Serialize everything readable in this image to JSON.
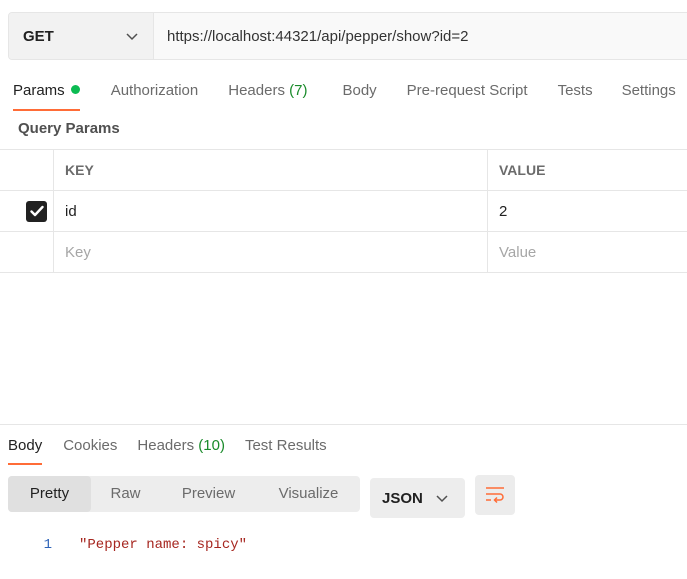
{
  "request": {
    "method": "GET",
    "url": "https://localhost:44321/api/pepper/show?id=2"
  },
  "request_tabs": [
    {
      "label": "Params",
      "active": true,
      "has_dot": true
    },
    {
      "label": "Authorization"
    },
    {
      "label": "Headers",
      "count": "(7)"
    },
    {
      "label": "Body"
    },
    {
      "label": "Pre-request Script"
    },
    {
      "label": "Tests"
    },
    {
      "label": "Settings"
    }
  ],
  "query_params": {
    "title": "Query Params",
    "headers": {
      "key": "KEY",
      "value": "VALUE"
    },
    "rows": [
      {
        "checked": true,
        "key": "id",
        "value": "2"
      }
    ],
    "placeholders": {
      "key": "Key",
      "value": "Value"
    }
  },
  "response_tabs": [
    {
      "label": "Body",
      "active": true
    },
    {
      "label": "Cookies"
    },
    {
      "label": "Headers",
      "count": "(10)"
    },
    {
      "label": "Test Results"
    }
  ],
  "view_modes": [
    "Pretty",
    "Raw",
    "Preview",
    "Visualize"
  ],
  "active_view": "Pretty",
  "format": "JSON",
  "response_body": {
    "line_number": "1",
    "text": "\"Pepper name: spicy\""
  },
  "colors": {
    "accent": "#ff6c37",
    "status_dot": "#0cbb52",
    "count": "#1a8b2b",
    "string": "#a6261f",
    "line_number": "#2e63b8"
  },
  "icons": {
    "method_dropdown": "chevron-down-icon",
    "checkbox": "check-icon",
    "format_dropdown": "chevron-down-icon",
    "wrap": "wrap-lines-icon"
  }
}
